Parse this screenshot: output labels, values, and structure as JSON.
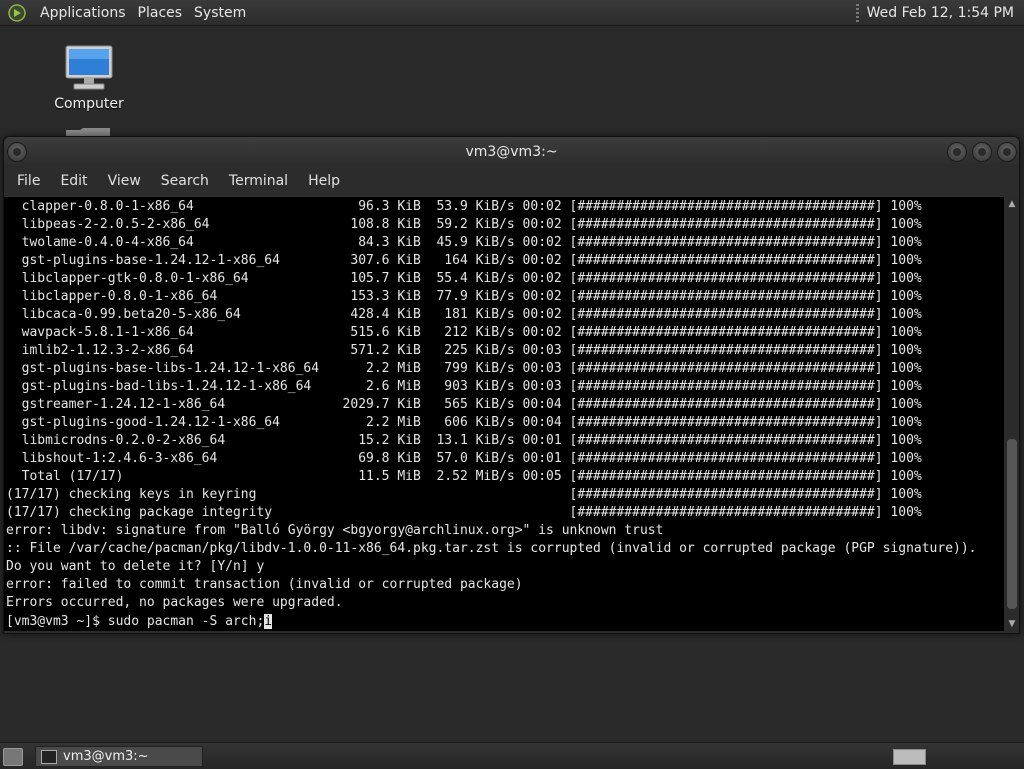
{
  "top_panel": {
    "menus": [
      "Applications",
      "Places",
      "System"
    ],
    "clock": "Wed Feb 12,  1:54 PM"
  },
  "desktop": {
    "icons": [
      {
        "label": "Computer",
        "icon": "computer-icon"
      }
    ]
  },
  "window": {
    "title": "vm3@vm3:~",
    "menus": [
      "File",
      "Edit",
      "View",
      "Search",
      "Terminal",
      "Help"
    ]
  },
  "terminal": {
    "lines": [
      "  clapper-0.8.0-1-x86_64                     96.3 KiB  53.9 KiB/s 00:02 [######################################] 100%",
      "  libpeas-2-2.0.5-2-x86_64                  108.8 KiB  59.2 KiB/s 00:02 [######################################] 100%",
      "  twolame-0.4.0-4-x86_64                     84.3 KiB  45.9 KiB/s 00:02 [######################################] 100%",
      "  gst-plugins-base-1.24.12-1-x86_64         307.6 KiB   164 KiB/s 00:02 [######################################] 100%",
      "  libclapper-gtk-0.8.0-1-x86_64             105.7 KiB  55.4 KiB/s 00:02 [######################################] 100%",
      "  libclapper-0.8.0-1-x86_64                 153.3 KiB  77.9 KiB/s 00:02 [######################################] 100%",
      "  libcaca-0.99.beta20-5-x86_64              428.4 KiB   181 KiB/s 00:02 [######################################] 100%",
      "  wavpack-5.8.1-1-x86_64                    515.6 KiB   212 KiB/s 00:02 [######################################] 100%",
      "  imlib2-1.12.3-2-x86_64                    571.2 KiB   225 KiB/s 00:03 [######################################] 100%",
      "  gst-plugins-base-libs-1.24.12-1-x86_64      2.2 MiB   799 KiB/s 00:03 [######################################] 100%",
      "  gst-plugins-bad-libs-1.24.12-1-x86_64       2.6 MiB   903 KiB/s 00:03 [######################################] 100%",
      "  gstreamer-1.24.12-1-x86_64               2029.7 KiB   565 KiB/s 00:04 [######################################] 100%",
      "  gst-plugins-good-1.24.12-1-x86_64           2.2 MiB   606 KiB/s 00:04 [######################################] 100%",
      "  libmicrodns-0.2.0-2-x86_64                 15.2 KiB  13.1 KiB/s 00:01 [######################################] 100%",
      "  libshout-1:2.4.6-3-x86_64                  69.8 KiB  57.0 KiB/s 00:01 [######################################] 100%",
      "  Total (17/17)                              11.5 MiB  2.52 MiB/s 00:05 [######################################] 100%",
      "(17/17) checking keys in keyring                                        [######################################] 100%",
      "(17/17) checking package integrity                                      [######################################] 100%",
      "error: libdv: signature from \"Balló György <bgyorgy@archlinux.org>\" is unknown trust",
      ":: File /var/cache/pacman/pkg/libdv-1.0.0-11-x86_64.pkg.tar.zst is corrupted (invalid or corrupted package (PGP signature)).",
      "Do you want to delete it? [Y/n] y",
      "error: failed to commit transaction (invalid or corrupted package)",
      "Errors occurred, no packages were upgraded."
    ],
    "prompt": "[vm3@vm3 ~]$ sudo pacman -S arch;",
    "cursor_char": "i"
  },
  "bottom_panel": {
    "task_label": "vm3@vm3:~"
  }
}
